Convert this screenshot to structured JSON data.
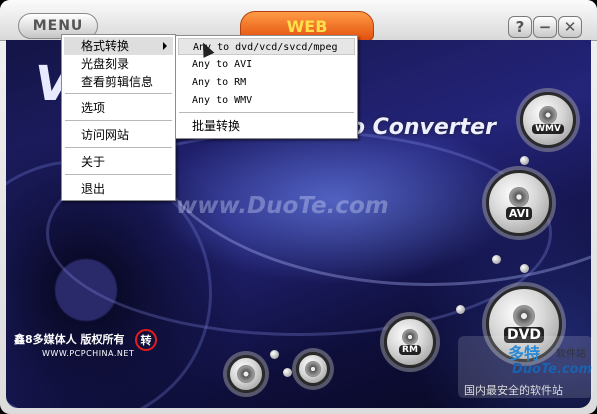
{
  "app": {
    "menu_button": "MENU",
    "web_button": "WEB",
    "help_button": "?",
    "minimize_button": "−",
    "close_button": "✕"
  },
  "branding": {
    "logo_letter": "V",
    "title_text": "Video Converter",
    "watermark": "www.DuoTe.com"
  },
  "format_buttons": {
    "wmv": "WMV",
    "avi": "AVI",
    "rm": "RM",
    "dvd": "DVD"
  },
  "credit": {
    "text": "鑫8多媒体人 版权所有",
    "url": "WWW.PCPCHINA.NET",
    "icon_text": "转"
  },
  "site_watermark": {
    "logo": "多特",
    "tag": "软件站",
    "domain": "DuoTe.com",
    "slogan": "国内最安全的软件站"
  },
  "main_menu": {
    "items": [
      {
        "label": "格式转换",
        "has_submenu": true,
        "active": true
      },
      {
        "label": "光盘刻录"
      },
      {
        "label": "查看剪辑信息"
      },
      {
        "label": "选项"
      },
      {
        "label": "访问网站"
      },
      {
        "label": "关于"
      },
      {
        "label": "退出"
      }
    ]
  },
  "submenu": {
    "items": [
      {
        "label": "Any to dvd/vcd/svcd/mpeg",
        "active": true
      },
      {
        "label": "Any to AVI"
      },
      {
        "label": "Any to RM"
      },
      {
        "label": "Any to WMV"
      },
      {
        "label": "批量转换"
      }
    ]
  },
  "colors": {
    "web_button": "#e3500e",
    "web_text": "#ffe04a",
    "background": "#1c1c66",
    "credit_ring": "#e31d1d"
  }
}
